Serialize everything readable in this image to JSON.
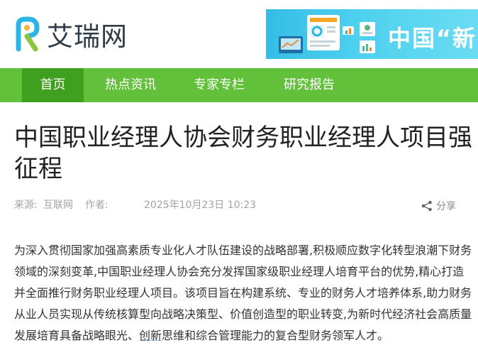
{
  "site": {
    "logo_text": "艾瑞网",
    "banner_text": "中国“新"
  },
  "nav": {
    "items": [
      {
        "label": "首页",
        "active": true
      },
      {
        "label": "热点资讯"
      },
      {
        "label": "专家专栏"
      },
      {
        "label": "研究报告"
      }
    ]
  },
  "article": {
    "title_line1": "中国职业经理人协会财务职业经理人项目强",
    "title_line2": "征程",
    "source_label": "来源:",
    "source": "互联网",
    "author_label": "作者:",
    "author": "",
    "datetime": "2025年10月23日 10:23",
    "share_label": "分享",
    "body_part1": "为深入贯彻国家加强高素质专业化人才队伍建设的战略部署,积极顺应数字化转型浪潮下财务领域的深刻变革,中国职业经理人协会充分发挥国家级职业经理人培育平台的优势,精心打造并全面推行财务职业经理人项目。该项目旨在构建系统、专业的财务人才培养体系,助力财务从业人员实现从传统核算型向战略决策型、价值创造型的职业转变,为新时代经济社会高质量发展培育具备战略眼光、",
    "body_link": "创新",
    "body_part2": "思维和综合管理能力的复合型财务领军人才。"
  },
  "colors": {
    "nav_bg": "#62c03a",
    "nav_active": "#3f9f1f",
    "banner": "#35bde6",
    "logo_dark": "#2f3b45"
  }
}
